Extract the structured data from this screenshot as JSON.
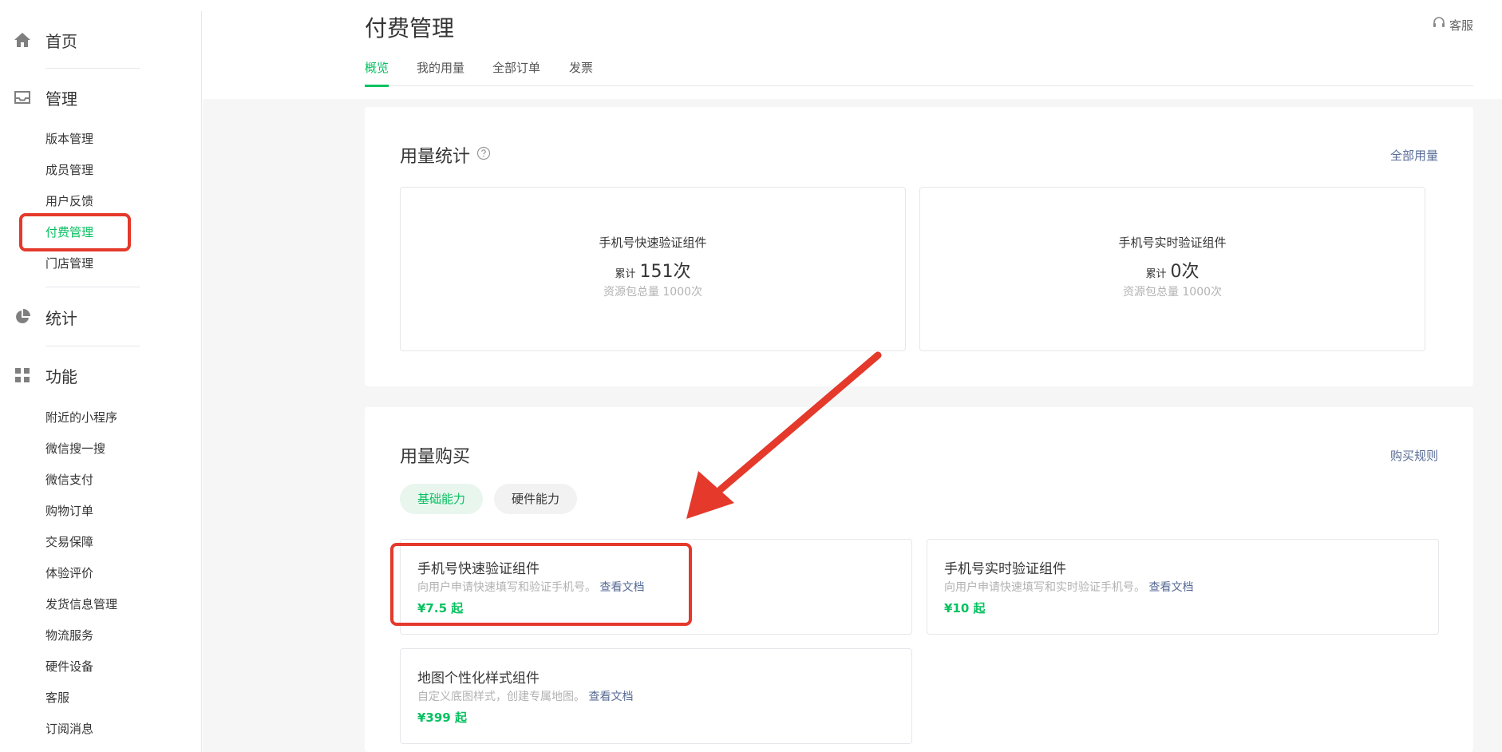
{
  "sidebar": {
    "home": {
      "label": "首页",
      "icon": "home-icon"
    },
    "manage": {
      "label": "管理",
      "icon": "inbox-icon",
      "items": [
        "版本管理",
        "成员管理",
        "用户反馈",
        "付费管理",
        "门店管理"
      ],
      "active_index": 3
    },
    "stats": {
      "label": "统计",
      "icon": "pie-chart-icon"
    },
    "features": {
      "label": "功能",
      "icon": "grid-icon",
      "items": [
        "附近的小程序",
        "微信搜一搜",
        "微信支付",
        "购物订单",
        "交易保障",
        "体验评价",
        "发货信息管理",
        "物流服务",
        "硬件设备",
        "客服",
        "订阅消息"
      ]
    }
  },
  "header": {
    "title": "付费管理",
    "support_label": "客服",
    "support_icon": "headset-icon"
  },
  "tabs": [
    {
      "label": "概览",
      "active": true
    },
    {
      "label": "我的用量",
      "active": false
    },
    {
      "label": "全部订单",
      "active": false
    },
    {
      "label": "发票",
      "active": false
    }
  ],
  "usage": {
    "title": "用量统计",
    "help_icon": "help-circle-icon",
    "link": "全部用量",
    "cards": [
      {
        "name": "手机号快速验证组件",
        "prefix": "累计",
        "count": "151次",
        "total": "资源包总量 1000次"
      },
      {
        "name": "手机号实时验证组件",
        "prefix": "累计",
        "count": "0次",
        "total": "资源包总量 1000次"
      }
    ]
  },
  "purchase": {
    "title": "用量购买",
    "link": "购买规则",
    "chips": [
      {
        "label": "基础能力",
        "active": true
      },
      {
        "label": "硬件能力",
        "active": false
      }
    ],
    "products": [
      {
        "name": "手机号快速验证组件",
        "desc": "向用户申请快速填写和验证手机号。",
        "doc": "查看文档",
        "price": "¥7.5 起"
      },
      {
        "name": "手机号实时验证组件",
        "desc": "向用户申请快速填写和实时验证手机号。",
        "doc": "查看文档",
        "price": "¥10 起"
      },
      {
        "name": "地图个性化样式组件",
        "desc": "自定义底图样式，创建专属地图。",
        "doc": "查看文档",
        "price": "¥399 起"
      }
    ]
  },
  "colors": {
    "accent": "#07c160",
    "link": "#576b95",
    "annotation": "#e4392b"
  }
}
